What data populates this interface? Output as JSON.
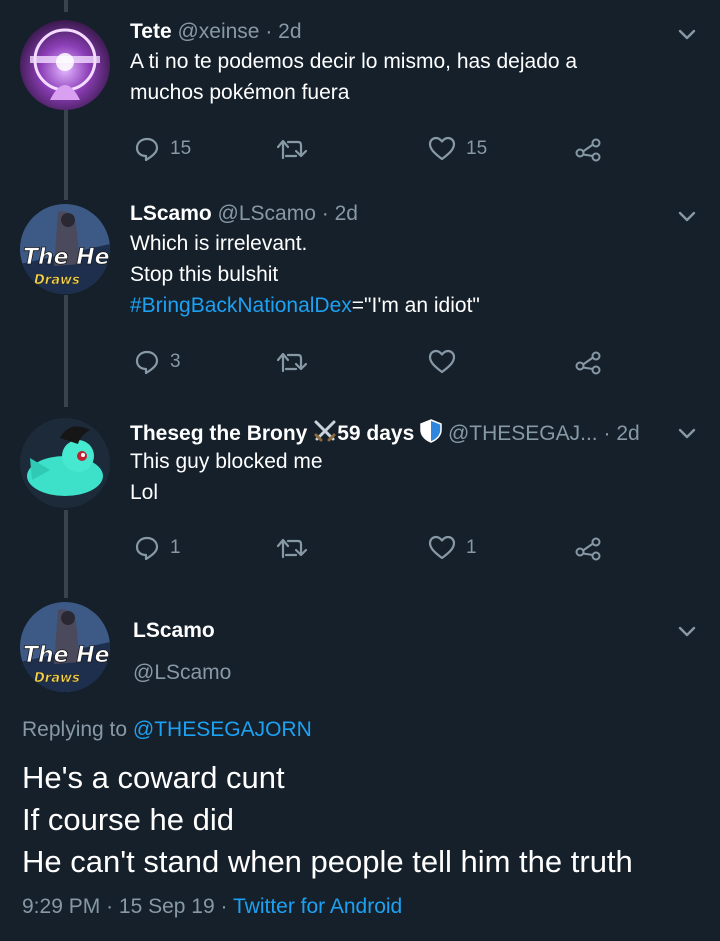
{
  "tweets": [
    {
      "name": "Tete",
      "handle": "@xeinse",
      "time": "· 2d",
      "lines": [
        "A ti no te podemos decir lo mismo, has dejado a",
        "muchos pokémon fuera"
      ],
      "replies": "15",
      "retweets": "",
      "likes": "15"
    },
    {
      "name": "LScamo",
      "handle": "@LScamo",
      "time": "· 2d",
      "lines": [
        "Which is irrelevant.",
        "Stop this bulshit"
      ],
      "hashtag": "#BringBackNationalDex",
      "hashtag_suffix": "=\"I'm an idiot\"",
      "replies": "3",
      "retweets": "",
      "likes": ""
    },
    {
      "name": "Theseg the Brony",
      "name_suffix": "59 days",
      "handle": "@THESEGAJ...",
      "time": "· 2d",
      "lines": [
        "This guy blocked me",
        "Lol"
      ],
      "replies": "1",
      "retweets": "",
      "likes": "1"
    }
  ],
  "main": {
    "name": "LScamo",
    "handle": "@LScamo",
    "replying_prefix": "Replying to",
    "replying_to": "@THESEGAJORN",
    "lines": [
      "He's a coward cunt",
      "If course he did",
      "He can't stand when people tell him the truth"
    ],
    "time": "9:29 PM",
    "date": "15 Sep 19",
    "source": "Twitter for Android"
  },
  "avatar_texts": {
    "brand": "The He",
    "sub": "Draws"
  },
  "colors": {
    "background": "#15202b",
    "secondary_text": "#8899a6",
    "link": "#1da1f2",
    "thread_line": "#38444d"
  },
  "icons": [
    "reply-icon",
    "retweet-icon",
    "like-icon",
    "share-icon",
    "chevron-down-icon",
    "crossed-swords-icon",
    "shield-icon"
  ]
}
